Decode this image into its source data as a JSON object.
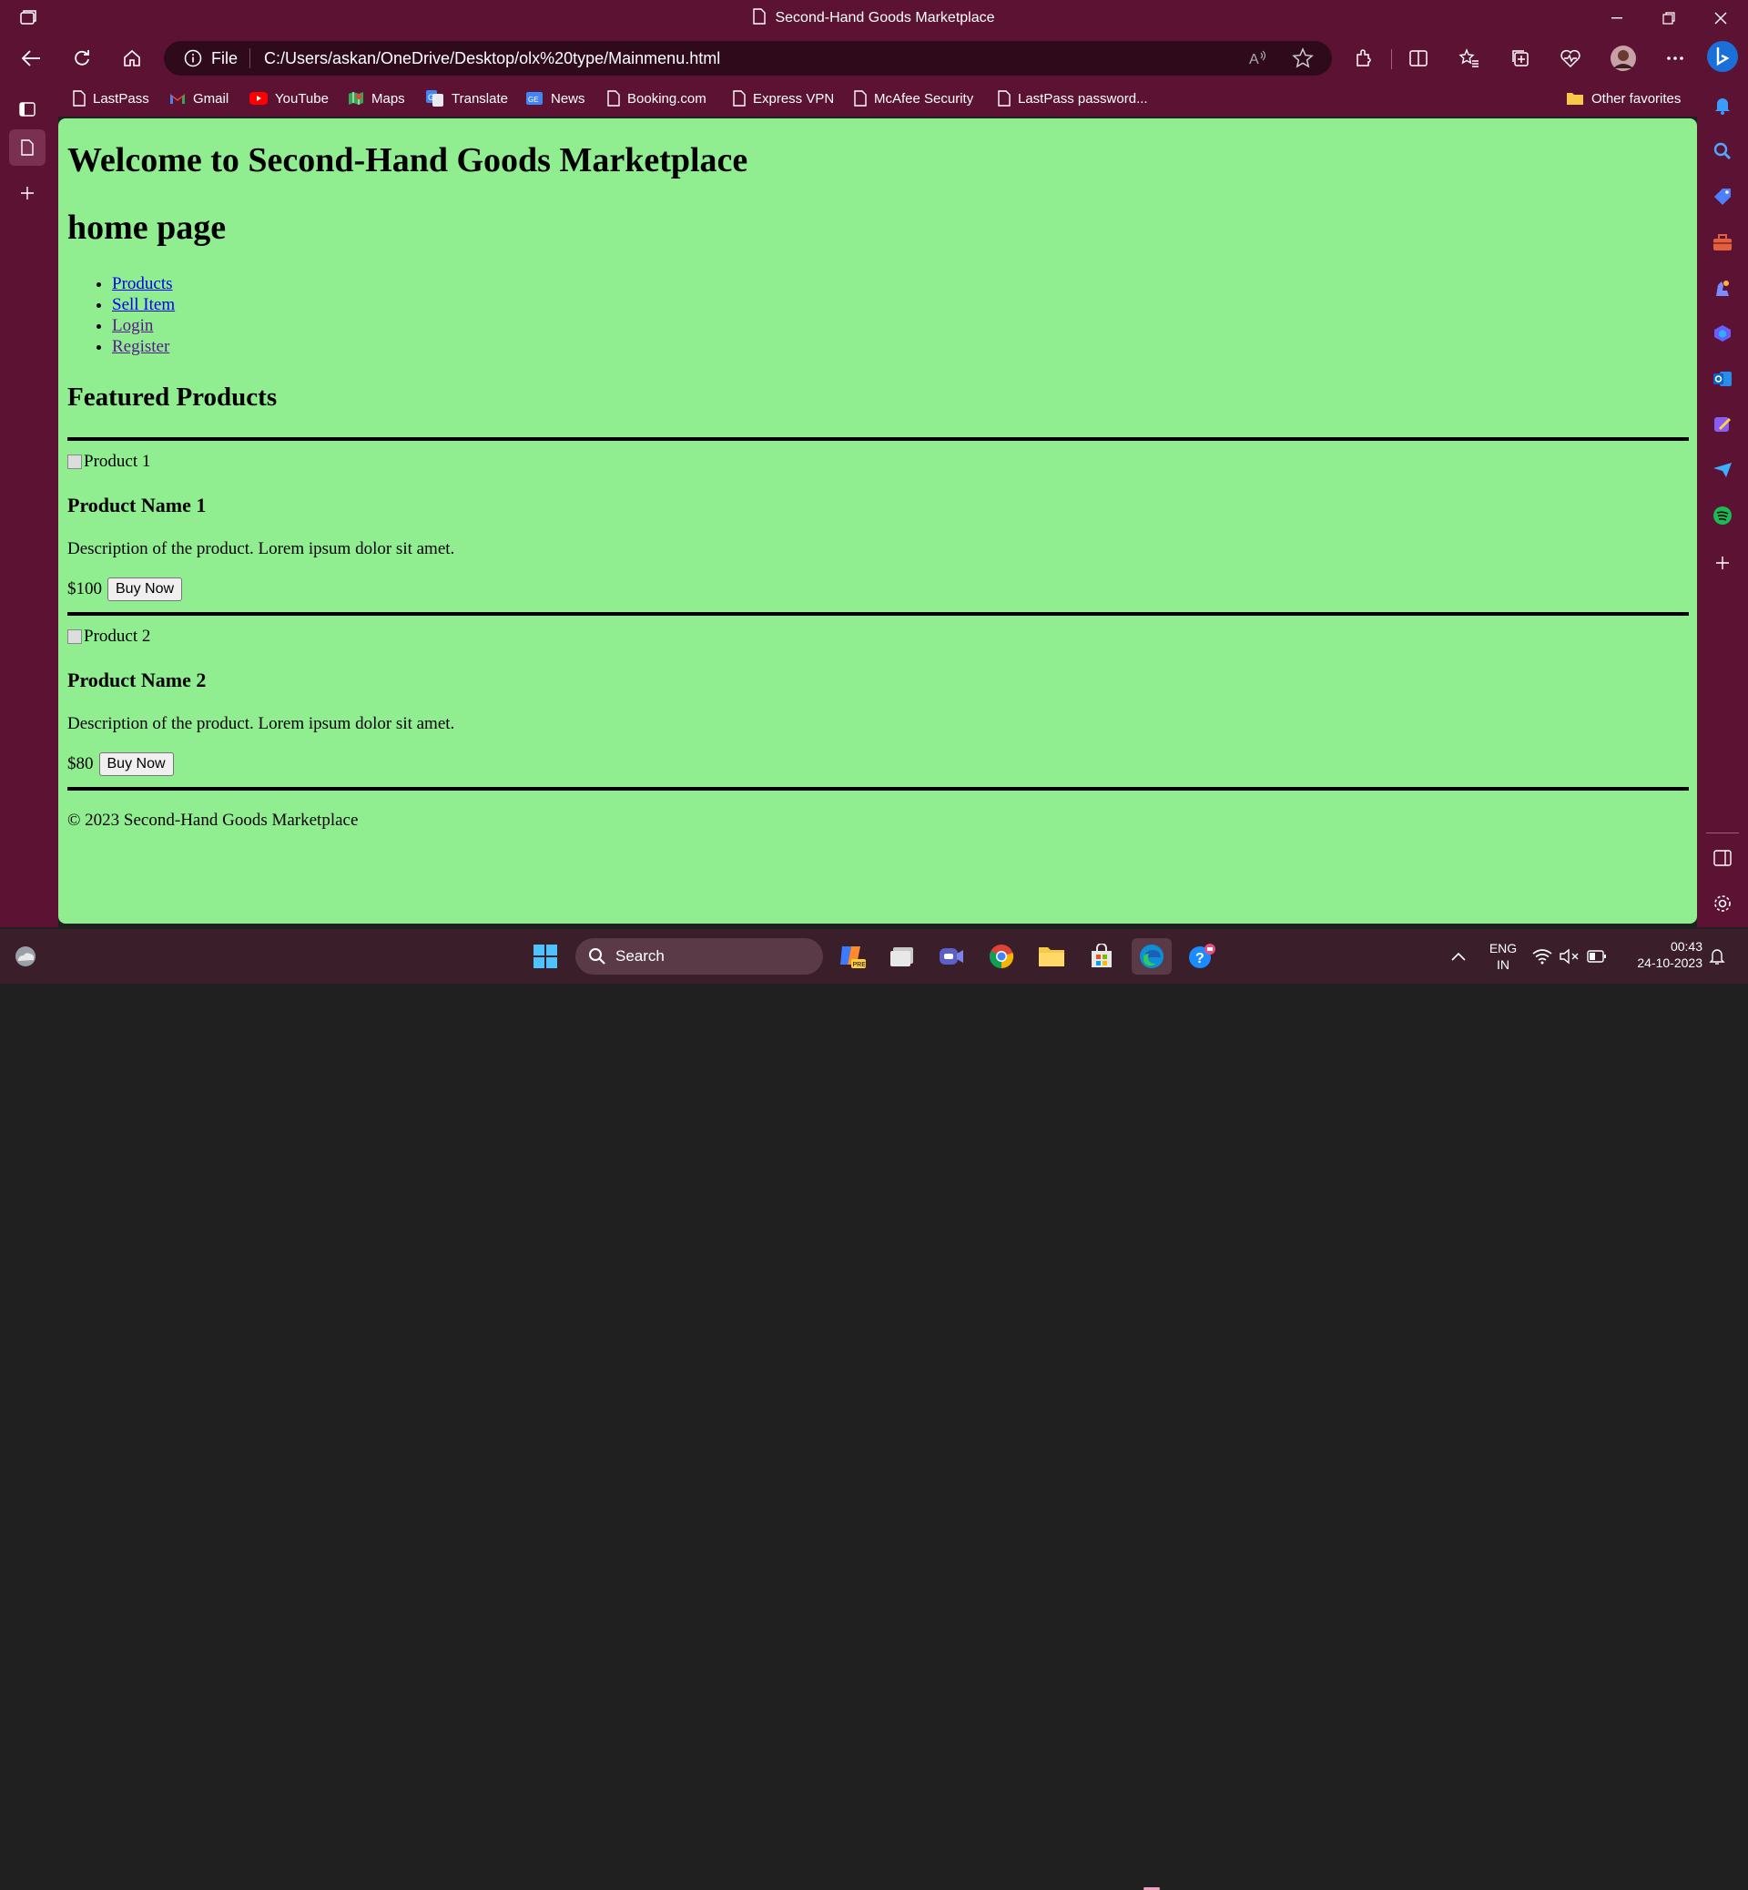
{
  "window": {
    "title": "Second-Hand Goods Marketplace"
  },
  "address_bar": {
    "scheme_label": "File",
    "url": "C:/Users/askan/OneDrive/Desktop/olx%20type/Mainmenu.html"
  },
  "favorites": [
    {
      "label": "LastPass",
      "icon": "page-icon"
    },
    {
      "label": "Gmail",
      "icon": "gmail-icon"
    },
    {
      "label": "YouTube",
      "icon": "youtube-icon"
    },
    {
      "label": "Maps",
      "icon": "maps-icon"
    },
    {
      "label": "Translate",
      "icon": "translate-icon"
    },
    {
      "label": "News",
      "icon": "news-icon"
    },
    {
      "label": "Booking.com",
      "icon": "page-icon"
    },
    {
      "label": "Express VPN",
      "icon": "page-icon"
    },
    {
      "label": "McAfee Security",
      "icon": "page-icon"
    },
    {
      "label": "LastPass password...",
      "icon": "page-icon"
    }
  ],
  "other_favorites": "Other favorites",
  "page": {
    "heading": "Welcome to Second-Hand Goods Marketplace",
    "subheading": "home page",
    "nav": [
      "Products",
      "Sell Item",
      "Login",
      "Register"
    ],
    "featured_heading": "Featured Products",
    "products": [
      {
        "image_alt": "Product 1",
        "name": "Product Name 1",
        "description": "Description of the product. Lorem ipsum dolor sit amet.",
        "price": "$100",
        "button": "Buy Now"
      },
      {
        "image_alt": "Product 2",
        "name": "Product Name 2",
        "description": "Description of the product. Lorem ipsum dolor sit amet.",
        "price": "$80",
        "button": "Buy Now"
      }
    ],
    "footer": "© 2023 Second-Hand Goods Marketplace"
  },
  "taskbar": {
    "search_label": "Search",
    "language": "ENG",
    "region": "IN",
    "time": "00:43",
    "date": "24-10-2023"
  },
  "colors": {
    "chrome": "#5c1232",
    "page_bg": "#90ee90",
    "link": "#0000ee",
    "visited_link": "#551a8b"
  }
}
